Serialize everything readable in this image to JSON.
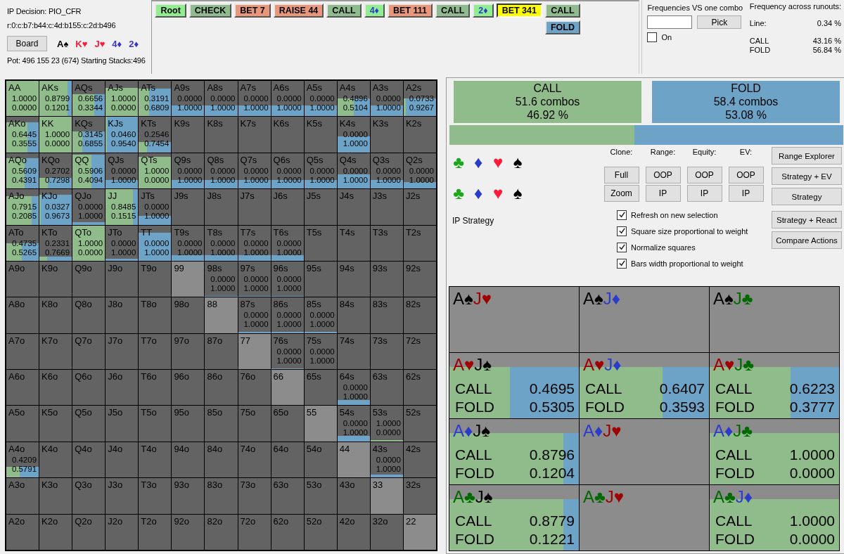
{
  "header": {
    "decision": "IP Decision:  PIO_CFR",
    "line": "r:0:c:b7:b44:c:4d:b155:c:2d:b496",
    "board_button": "Board",
    "board": [
      {
        "text": "A♠",
        "color": "#000000"
      },
      {
        "text": "K♥",
        "color": "#ff1a3a"
      },
      {
        "text": "J♥",
        "color": "#ff1a3a"
      },
      {
        "text": "4♦",
        "color": "#3535c8"
      },
      {
        "text": "2♦",
        "color": "#3535c8"
      }
    ],
    "pot": "Pot: 496 155 23 (674) Starting Stacks:496"
  },
  "tree": [
    [
      {
        "label": "Root",
        "kind": "action",
        "color": "#90ee90",
        "selected": false
      }
    ],
    [
      {
        "label": "CHECK",
        "kind": "action",
        "color": "#8fbc8f",
        "selected": false
      }
    ],
    [
      {
        "label": "BET 7",
        "kind": "action",
        "color": "#e9967a",
        "selected": false
      }
    ],
    [
      {
        "label": "RAISE 44",
        "kind": "action",
        "color": "#e9967a",
        "selected": false
      }
    ],
    [
      {
        "label": "CALL",
        "kind": "action",
        "color": "#8fbc8f",
        "selected": false
      }
    ],
    [
      {
        "label": "4♦",
        "kind": "card",
        "color": "#90ee90",
        "selected": false
      }
    ],
    [
      {
        "label": "BET 111",
        "kind": "action",
        "color": "#e9967a",
        "selected": false
      }
    ],
    [
      {
        "label": "CALL",
        "kind": "action",
        "color": "#8fbc8f",
        "selected": false
      }
    ],
    [
      {
        "label": "2♦",
        "kind": "card",
        "color": "#90ee90",
        "selected": false
      }
    ],
    [
      {
        "label": "BET 341",
        "kind": "action",
        "color": "#ffff00",
        "selected": true
      }
    ],
    [
      {
        "label": "CALL",
        "kind": "action",
        "color": "#8fbc8f",
        "selected": false
      },
      {
        "label": "FOLD",
        "kind": "action",
        "color": "#6ca3c7",
        "selected": false
      }
    ]
  ],
  "combo_picker": {
    "title": "Frequencies VS one combo",
    "button": "Pick",
    "toggle": {
      "label": "On",
      "checked": false
    }
  },
  "runouts": {
    "title": "Frequency across runouts:",
    "line_label": "Line:",
    "line_value": "0.34 %",
    "rows": [
      {
        "label": "CALL",
        "value": "43.16 %"
      },
      {
        "label": "FOLD",
        "value": "56.84 %"
      }
    ]
  },
  "grid": [
    [
      {
        "label": "AA",
        "kind": "strategy",
        "weight": {
          "level": 1
        },
        "call": "1.0000",
        "fold": "0.0000"
      },
      {
        "label": "AKs",
        "kind": "strategy",
        "weight": {
          "level": 1
        },
        "call": "0.8799",
        "fold": "0.1201"
      },
      {
        "label": "AQs",
        "kind": "strategy",
        "weight": {
          "level": 0.62
        },
        "call": "0.6656",
        "fold": "0.3344"
      },
      {
        "label": "AJs",
        "kind": "strategy",
        "weight": {
          "level": 0.8
        },
        "call": "1.0000",
        "fold": "0.0000"
      },
      {
        "label": "ATs",
        "kind": "strategy",
        "weight": {
          "level": 0.78
        },
        "call": "0.3191",
        "fold": "0.6809"
      },
      {
        "label": "A9s",
        "kind": "strategy",
        "weight": {
          "level": 0.3
        },
        "call": "0.0000",
        "fold": "1.0000"
      },
      {
        "label": "A8s",
        "kind": "strategy",
        "weight": {
          "level": 0.3
        },
        "call": "0.0000",
        "fold": "1.0000"
      },
      {
        "label": "A7s",
        "kind": "strategy",
        "weight": {
          "level": 0.3
        },
        "call": "0.0000",
        "fold": "1.0000"
      },
      {
        "label": "A6s",
        "kind": "strategy",
        "weight": {
          "level": 0.3
        },
        "call": "0.0000",
        "fold": "1.0000"
      },
      {
        "label": "A5s",
        "kind": "strategy",
        "weight": {
          "level": 0.3
        },
        "call": "0.0000",
        "fold": "1.0000"
      },
      {
        "label": "A4s",
        "kind": "strategy",
        "weight": {
          "level": 0.5
        },
        "call": "0.4896",
        "fold": "0.5104"
      },
      {
        "label": "A3s",
        "kind": "strategy",
        "weight": {
          "level": 0.3
        },
        "call": "0.0000",
        "fold": "1.0000"
      },
      {
        "label": "A2s",
        "kind": "strategy",
        "weight": {
          "level": 0.5
        },
        "call": "0.0733",
        "fold": "0.9267"
      }
    ],
    [
      {
        "label": "AKo",
        "kind": "strategy",
        "weight": {
          "level": 0.85
        },
        "call": "0.6445",
        "fold": "0.3555"
      },
      {
        "label": "KK",
        "kind": "strategy",
        "weight": {
          "level": 1
        },
        "call": "1.0000",
        "fold": "0.0000"
      },
      {
        "label": "KQs",
        "kind": "strategy",
        "weight": {
          "level": 0.6
        },
        "call": "0.3145",
        "fold": "0.6855"
      },
      {
        "label": "KJs",
        "kind": "strategy",
        "weight": {
          "level": 1
        },
        "call": "0.0460",
        "fold": "0.9540"
      },
      {
        "label": "KTs",
        "kind": "strategy",
        "weight": {
          "level": 0.3
        },
        "call": "0.2546",
        "fold": "0.7454"
      },
      {
        "label": "K9s",
        "kind": "empty"
      },
      {
        "label": "K8s",
        "kind": "empty"
      },
      {
        "label": "K7s",
        "kind": "empty"
      },
      {
        "label": "K6s",
        "kind": "empty"
      },
      {
        "label": "K5s",
        "kind": "empty"
      },
      {
        "label": "K4s",
        "kind": "strategy",
        "weight": {
          "level": 0.45
        },
        "call": "0.0000",
        "fold": "1.0000"
      },
      {
        "label": "K3s",
        "kind": "empty"
      },
      {
        "label": "K2s",
        "kind": "empty"
      }
    ],
    [
      {
        "label": "AQo",
        "kind": "strategy",
        "weight": {
          "level": 0.85
        },
        "call": "0.5609",
        "fold": "0.4391"
      },
      {
        "label": "KQo",
        "kind": "strategy",
        "weight": {
          "level": 0.3
        },
        "call": "0.2702",
        "fold": "0.7298"
      },
      {
        "label": "QQ",
        "kind": "strategy",
        "weight": {
          "level": 0.95
        },
        "call": "0.5906",
        "fold": "0.4094"
      },
      {
        "label": "QJs",
        "kind": "strategy",
        "weight": {
          "level": 0.25
        },
        "call": "0.0000",
        "fold": "1.0000"
      },
      {
        "label": "QTs",
        "kind": "strategy",
        "weight": {
          "level": 0.9
        },
        "call": "1.0000",
        "fold": "0.0000"
      },
      {
        "label": "Q9s",
        "kind": "strategy",
        "weight": {
          "level": 0.25
        },
        "call": "0.0000",
        "fold": "1.0000"
      },
      {
        "label": "Q8s",
        "kind": "strategy",
        "weight": {
          "level": 0.25
        },
        "call": "0.0000",
        "fold": "1.0000"
      },
      {
        "label": "Q7s",
        "kind": "strategy",
        "weight": {
          "level": 0.25
        },
        "call": "0.0000",
        "fold": "1.0000"
      },
      {
        "label": "Q6s",
        "kind": "strategy",
        "weight": {
          "level": 0.25
        },
        "call": "0.0000",
        "fold": "1.0000"
      },
      {
        "label": "Q5s",
        "kind": "strategy",
        "weight": {
          "level": 0.25
        },
        "call": "0.0000",
        "fold": "1.0000"
      },
      {
        "label": "Q4s",
        "kind": "strategy",
        "weight": {
          "level": 0.4
        },
        "call": "0.0000",
        "fold": "1.0000"
      },
      {
        "label": "Q3s",
        "kind": "strategy",
        "weight": {
          "level": 0.25
        },
        "call": "0.0000",
        "fold": "1.0000"
      },
      {
        "label": "Q2s",
        "kind": "strategy",
        "weight": {
          "level": 0.18
        },
        "call": "0.0000",
        "fold": "1.0000"
      }
    ],
    [
      {
        "label": "AJo",
        "kind": "strategy",
        "weight": {
          "level": 0.8
        },
        "call": "0.7915",
        "fold": "0.2085"
      },
      {
        "label": "KJo",
        "kind": "strategy",
        "weight": {
          "level": 0.85
        },
        "call": "0.0327",
        "fold": "0.9673"
      },
      {
        "label": "QJo",
        "kind": "strategy",
        "weight": {
          "level": 0.07
        },
        "call": "0.0000",
        "fold": "1.0000"
      },
      {
        "label": "JJ",
        "kind": "strategy",
        "weight": {
          "level": 1
        },
        "call": "0.8485",
        "fold": "0.1515"
      },
      {
        "label": "JTs",
        "kind": "strategy",
        "weight": {
          "level": 0.25
        },
        "call": "0.0000",
        "fold": "1.0000"
      },
      {
        "label": "J9s",
        "kind": "empty"
      },
      {
        "label": "J8s",
        "kind": "empty"
      },
      {
        "label": "J7s",
        "kind": "empty"
      },
      {
        "label": "J6s",
        "kind": "empty"
      },
      {
        "label": "J5s",
        "kind": "empty"
      },
      {
        "label": "J4s",
        "kind": "empty"
      },
      {
        "label": "J3s",
        "kind": "empty"
      },
      {
        "label": "J2s",
        "kind": "empty"
      }
    ],
    [
      {
        "label": "ATo",
        "kind": "strategy",
        "weight": {
          "level": 0.5
        },
        "call": "0.4735",
        "fold": "0.5265"
      },
      {
        "label": "KTo",
        "kind": "strategy",
        "weight": {
          "level": 0.12
        },
        "call": "0.2331",
        "fold": "0.7669"
      },
      {
        "label": "QTo",
        "kind": "strategy",
        "weight": {
          "level": 1
        },
        "call": "1.0000",
        "fold": "0.0000"
      },
      {
        "label": "JTo",
        "kind": "strategy",
        "weight": {
          "level": 0.06
        },
        "call": "0.0000",
        "fold": "1.0000"
      },
      {
        "label": "TT",
        "kind": "strategy",
        "weight": {
          "level": 0.8
        },
        "call": "0.0000",
        "fold": "1.0000"
      },
      {
        "label": "T9s",
        "kind": "strategy",
        "weight": {
          "level": 0.15
        },
        "call": "0.0000",
        "fold": "1.0000"
      },
      {
        "label": "T8s",
        "kind": "strategy",
        "weight": {
          "level": 0.15
        },
        "call": "0.0000",
        "fold": "1.0000"
      },
      {
        "label": "T7s",
        "kind": "strategy",
        "weight": {
          "level": 0.15
        },
        "call": "0.0000",
        "fold": "1.0000"
      },
      {
        "label": "T6s",
        "kind": "strategy",
        "weight": {
          "level": 0.15
        },
        "call": "0.0000",
        "fold": "1.0000"
      },
      {
        "label": "T5s",
        "kind": "empty"
      },
      {
        "label": "T4s",
        "kind": "empty"
      },
      {
        "label": "T3s",
        "kind": "empty"
      },
      {
        "label": "T2s",
        "kind": "empty"
      }
    ],
    [
      {
        "label": "A9o",
        "kind": "empty"
      },
      {
        "label": "K9o",
        "kind": "empty"
      },
      {
        "label": "Q9o",
        "kind": "empty"
      },
      {
        "label": "J9o",
        "kind": "empty"
      },
      {
        "label": "T9o",
        "kind": "empty"
      },
      {
        "label": "99",
        "kind": "blocked"
      },
      {
        "label": "98s",
        "kind": "strategy",
        "weight": {
          "level": 0.03
        },
        "call": "0.0000",
        "fold": "1.0000"
      },
      {
        "label": "97s",
        "kind": "strategy",
        "weight": {
          "level": 0.03
        },
        "call": "0.0000",
        "fold": "1.0000"
      },
      {
        "label": "96s",
        "kind": "strategy",
        "weight": {
          "level": 0.03
        },
        "call": "0.0000",
        "fold": "1.0000"
      },
      {
        "label": "95s",
        "kind": "empty"
      },
      {
        "label": "94s",
        "kind": "empty"
      },
      {
        "label": "93s",
        "kind": "empty"
      },
      {
        "label": "92s",
        "kind": "empty"
      }
    ],
    [
      {
        "label": "A8o",
        "kind": "empty"
      },
      {
        "label": "K8o",
        "kind": "empty"
      },
      {
        "label": "Q8o",
        "kind": "empty"
      },
      {
        "label": "J8o",
        "kind": "empty"
      },
      {
        "label": "T8o",
        "kind": "empty"
      },
      {
        "label": "98o",
        "kind": "empty"
      },
      {
        "label": "88",
        "kind": "blocked"
      },
      {
        "label": "87s",
        "kind": "strategy",
        "weight": {
          "level": 0.03
        },
        "call": "0.0000",
        "fold": "1.0000"
      },
      {
        "label": "86s",
        "kind": "strategy",
        "weight": {
          "level": 0.03
        },
        "call": "0.0000",
        "fold": "1.0000"
      },
      {
        "label": "85s",
        "kind": "strategy",
        "weight": {
          "level": 0.03
        },
        "call": "0.0000",
        "fold": "1.0000"
      },
      {
        "label": "84s",
        "kind": "empty"
      },
      {
        "label": "83s",
        "kind": "empty"
      },
      {
        "label": "82s",
        "kind": "empty"
      }
    ],
    [
      {
        "label": "A7o",
        "kind": "empty"
      },
      {
        "label": "K7o",
        "kind": "empty"
      },
      {
        "label": "Q7o",
        "kind": "empty"
      },
      {
        "label": "J7o",
        "kind": "empty"
      },
      {
        "label": "T7o",
        "kind": "empty"
      },
      {
        "label": "97o",
        "kind": "empty"
      },
      {
        "label": "87o",
        "kind": "empty"
      },
      {
        "label": "77",
        "kind": "blocked"
      },
      {
        "label": "76s",
        "kind": "strategy",
        "weight": {
          "level": 0.03
        },
        "call": "0.0000",
        "fold": "1.0000"
      },
      {
        "label": "75s",
        "kind": "strategy",
        "weight": {
          "level": 0.01
        },
        "call": "0.0000",
        "fold": "1.0000"
      },
      {
        "label": "74s",
        "kind": "empty"
      },
      {
        "label": "73s",
        "kind": "empty"
      },
      {
        "label": "72s",
        "kind": "empty"
      }
    ],
    [
      {
        "label": "A6o",
        "kind": "empty"
      },
      {
        "label": "K6o",
        "kind": "empty"
      },
      {
        "label": "Q6o",
        "kind": "empty"
      },
      {
        "label": "J6o",
        "kind": "empty"
      },
      {
        "label": "T6o",
        "kind": "empty"
      },
      {
        "label": "96o",
        "kind": "empty"
      },
      {
        "label": "86o",
        "kind": "empty"
      },
      {
        "label": "76o",
        "kind": "empty"
      },
      {
        "label": "66",
        "kind": "blocked"
      },
      {
        "label": "65s",
        "kind": "empty"
      },
      {
        "label": "64s",
        "kind": "strategy",
        "weight": {
          "level": 0.15
        },
        "call": "0.0000",
        "fold": "1.0000"
      },
      {
        "label": "63s",
        "kind": "empty"
      },
      {
        "label": "62s",
        "kind": "empty"
      }
    ],
    [
      {
        "label": "A5o",
        "kind": "empty"
      },
      {
        "label": "K5o",
        "kind": "empty"
      },
      {
        "label": "Q5o",
        "kind": "empty"
      },
      {
        "label": "J5o",
        "kind": "empty"
      },
      {
        "label": "T5o",
        "kind": "empty"
      },
      {
        "label": "95o",
        "kind": "empty"
      },
      {
        "label": "85o",
        "kind": "empty"
      },
      {
        "label": "75o",
        "kind": "empty"
      },
      {
        "label": "65o",
        "kind": "empty"
      },
      {
        "label": "55",
        "kind": "blocked"
      },
      {
        "label": "54s",
        "kind": "strategy",
        "weight": {
          "level": 0.15
        },
        "call": "0.0000",
        "fold": "1.0000"
      },
      {
        "label": "53s",
        "kind": "strategy",
        "weight": {
          "level": 0.03
        },
        "call": "1.0000",
        "fold": "0.0000"
      },
      {
        "label": "52s",
        "kind": "empty"
      }
    ],
    [
      {
        "label": "A4o",
        "kind": "strategy",
        "weight": {
          "level": 0.3
        },
        "call": "0.4209",
        "fold": "0.5791"
      },
      {
        "label": "K4o",
        "kind": "empty"
      },
      {
        "label": "Q4o",
        "kind": "empty"
      },
      {
        "label": "J4o",
        "kind": "empty"
      },
      {
        "label": "T4o",
        "kind": "empty"
      },
      {
        "label": "94o",
        "kind": "empty"
      },
      {
        "label": "84o",
        "kind": "empty"
      },
      {
        "label": "74o",
        "kind": "empty"
      },
      {
        "label": "64o",
        "kind": "empty"
      },
      {
        "label": "54o",
        "kind": "empty"
      },
      {
        "label": "44",
        "kind": "blocked"
      },
      {
        "label": "43s",
        "kind": "strategy",
        "weight": {
          "level": 0.08
        },
        "call": "0.0000",
        "fold": "1.0000"
      },
      {
        "label": "42s",
        "kind": "empty"
      }
    ],
    [
      {
        "label": "A3o",
        "kind": "empty"
      },
      {
        "label": "K3o",
        "kind": "empty"
      },
      {
        "label": "Q3o",
        "kind": "empty"
      },
      {
        "label": "J3o",
        "kind": "empty"
      },
      {
        "label": "T3o",
        "kind": "empty"
      },
      {
        "label": "93o",
        "kind": "empty"
      },
      {
        "label": "83o",
        "kind": "empty"
      },
      {
        "label": "73o",
        "kind": "empty"
      },
      {
        "label": "63o",
        "kind": "empty"
      },
      {
        "label": "53o",
        "kind": "empty"
      },
      {
        "label": "43o",
        "kind": "empty"
      },
      {
        "label": "33",
        "kind": "blocked"
      },
      {
        "label": "32s",
        "kind": "empty"
      }
    ],
    [
      {
        "label": "A2o",
        "kind": "empty"
      },
      {
        "label": "K2o",
        "kind": "empty"
      },
      {
        "label": "Q2o",
        "kind": "empty"
      },
      {
        "label": "J2o",
        "kind": "empty"
      },
      {
        "label": "T2o",
        "kind": "empty"
      },
      {
        "label": "92o",
        "kind": "empty"
      },
      {
        "label": "82o",
        "kind": "empty"
      },
      {
        "label": "72o",
        "kind": "empty"
      },
      {
        "label": "62o",
        "kind": "empty"
      },
      {
        "label": "52o",
        "kind": "empty"
      },
      {
        "label": "42o",
        "kind": "empty"
      },
      {
        "label": "32o",
        "kind": "empty"
      },
      {
        "label": "22",
        "kind": "blocked"
      }
    ]
  ],
  "summary": {
    "actions": [
      {
        "label": "CALL",
        "combos": "51.6 combos",
        "percent": "46.92 %",
        "color": "#8fbc8a"
      },
      {
        "label": "FOLD",
        "combos": "58.4 combos",
        "percent": "53.08 %",
        "color": "#6ca3c7"
      }
    ],
    "bar": {
      "level": 0.4692
    }
  },
  "suit_filters": [
    [
      {
        "text": "♣",
        "color": "#1aa81a"
      },
      {
        "text": "♦",
        "color": "#2b3bcc"
      },
      {
        "text": "♥",
        "color": "#ff1a3a"
      },
      {
        "text": "♠",
        "color": "#000000"
      }
    ],
    [
      {
        "text": "♣",
        "color": "#1aa81a"
      },
      {
        "text": "♦",
        "color": "#2b3bcc"
      },
      {
        "text": "♥",
        "color": "#ff1a3a"
      },
      {
        "text": "♠",
        "color": "#000000"
      }
    ]
  ],
  "view_label": "IP Strategy",
  "clone_groups": [
    {
      "label": "Clone:",
      "buttons": [
        "Full",
        "Zoom"
      ]
    },
    {
      "label": "Range:",
      "buttons": [
        "OOP",
        "IP"
      ]
    },
    {
      "label": "Equity:",
      "buttons": [
        "OOP",
        "IP"
      ]
    },
    {
      "label": "EV:",
      "buttons": [
        "OOP",
        "IP"
      ]
    }
  ],
  "options": [
    {
      "label": "Refresh on new selection",
      "checked": true
    },
    {
      "label": "Square size proportional to weight",
      "checked": true
    },
    {
      "label": "Normalize squares",
      "checked": true
    },
    {
      "label": "Bars width proportional to weight",
      "checked": true
    }
  ],
  "side_buttons": [
    "Range Explorer",
    "Strategy + EV",
    "Strategy",
    "Strategy + React",
    "Compare Actions"
  ],
  "combos": [
    {
      "cards": [
        {
          "text": "A♠",
          "color": "#000000"
        },
        {
          "text": "J♥",
          "color": "#a00000"
        }
      ]
    },
    {
      "cards": [
        {
          "text": "A♠",
          "color": "#000000"
        },
        {
          "text": "J♦",
          "color": "#2b3bcc"
        }
      ]
    },
    {
      "cards": [
        {
          "text": "A♠",
          "color": "#000000"
        },
        {
          "text": "J♣",
          "color": "#006a00"
        }
      ]
    },
    {
      "cards": [
        {
          "text": "A♥",
          "color": "#a00000"
        },
        {
          "text": "J♠",
          "color": "#000000"
        }
      ],
      "call": {
        "label": "CALL",
        "value": "0.4695"
      },
      "fold": {
        "label": "FOLD",
        "value": "0.5305"
      }
    },
    {
      "cards": [
        {
          "text": "A♥",
          "color": "#a00000"
        },
        {
          "text": "J♦",
          "color": "#2b3bcc"
        }
      ],
      "call": {
        "label": "CALL",
        "value": "0.6407"
      },
      "fold": {
        "label": "FOLD",
        "value": "0.3593"
      }
    },
    {
      "cards": [
        {
          "text": "A♥",
          "color": "#a00000"
        },
        {
          "text": "J♣",
          "color": "#006a00"
        }
      ],
      "call": {
        "label": "CALL",
        "value": "0.6223"
      },
      "fold": {
        "label": "FOLD",
        "value": "0.3777"
      }
    },
    {
      "cards": [
        {
          "text": "A♦",
          "color": "#2b3bcc"
        },
        {
          "text": "J♠",
          "color": "#000000"
        }
      ],
      "call": {
        "label": "CALL",
        "value": "0.8796"
      },
      "fold": {
        "label": "FOLD",
        "value": "0.1204"
      }
    },
    {
      "cards": [
        {
          "text": "A♦",
          "color": "#2b3bcc"
        },
        {
          "text": "J♥",
          "color": "#a00000"
        }
      ]
    },
    {
      "cards": [
        {
          "text": "A♦",
          "color": "#2b3bcc"
        },
        {
          "text": "J♣",
          "color": "#006a00"
        }
      ],
      "call": {
        "label": "CALL",
        "value": "1.0000"
      },
      "fold": {
        "label": "FOLD",
        "value": "0.0000"
      }
    },
    {
      "cards": [
        {
          "text": "A♣",
          "color": "#006a00"
        },
        {
          "text": "J♠",
          "color": "#000000"
        }
      ],
      "call": {
        "label": "CALL",
        "value": "0.8779"
      },
      "fold": {
        "label": "FOLD",
        "value": "0.1221"
      }
    },
    {
      "cards": [
        {
          "text": "A♣",
          "color": "#006a00"
        },
        {
          "text": "J♥",
          "color": "#a00000"
        }
      ]
    },
    {
      "cards": [
        {
          "text": "A♣",
          "color": "#006a00"
        },
        {
          "text": "J♦",
          "color": "#2b3bcc"
        }
      ],
      "call": {
        "label": "CALL",
        "value": "1.0000"
      },
      "fold": {
        "label": "FOLD",
        "value": "0.0000"
      }
    }
  ]
}
